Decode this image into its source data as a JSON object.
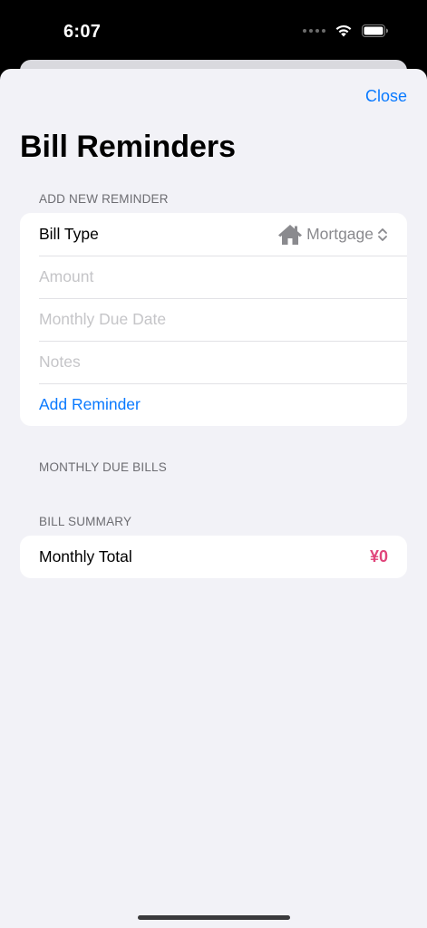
{
  "status_bar": {
    "time": "6:07"
  },
  "header": {
    "close_label": "Close",
    "title": "Bill Reminders"
  },
  "add_section": {
    "header": "ADD NEW REMINDER",
    "bill_type_label": "Bill Type",
    "bill_type_value": "Mortgage",
    "bill_type_icon": "house-icon",
    "amount_placeholder": "Amount",
    "due_date_placeholder": "Monthly Due Date",
    "notes_placeholder": "Notes",
    "add_button_label": "Add Reminder"
  },
  "due_section": {
    "header": "MONTHLY DUE BILLS"
  },
  "summary_section": {
    "header": "BILL SUMMARY",
    "total_label": "Monthly Total",
    "total_value": "¥0"
  },
  "colors": {
    "accent": "#0a7aff",
    "total": "#e0457b",
    "background": "#f2f2f7"
  }
}
